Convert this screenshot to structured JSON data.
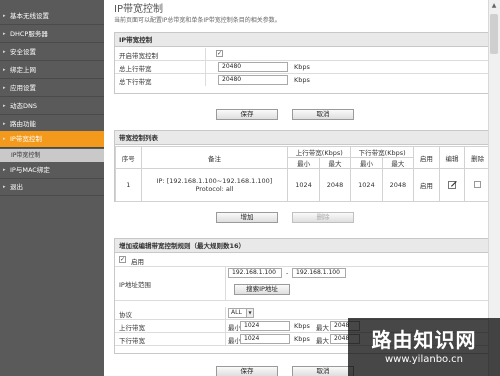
{
  "sidebar": {
    "items": [
      {
        "label": "基本无线设置"
      },
      {
        "label": "DHCP服务器"
      },
      {
        "label": "安全设置"
      },
      {
        "label": "绑定上网"
      },
      {
        "label": "应用设置"
      },
      {
        "label": "动态DNS"
      },
      {
        "label": "路由功能"
      },
      {
        "label": "IP带宽控制"
      }
    ],
    "subitems": [
      {
        "label": "IP带宽控制"
      },
      {
        "label": "IP与MAC绑定"
      }
    ],
    "last_item": {
      "label": "退出"
    }
  },
  "page": {
    "title": "IP带宽控制",
    "description": "当前页面可以配置IP总带宽和单条IP带宽控制条目的相关参数。"
  },
  "bandwidth_panel": {
    "header": "IP带宽控制",
    "enable_label": "开启带宽控制",
    "enable_checked": true,
    "up_label": "总上行带宽",
    "up_value": "20480",
    "down_label": "总下行带宽",
    "down_value": "20480",
    "unit": "Kbps"
  },
  "buttons": {
    "save": "保存",
    "cancel": "取消",
    "add": "增加",
    "delete": "删除",
    "search_ip": "搜索IP地址"
  },
  "rule_list": {
    "header": "带宽控制列表",
    "columns": {
      "seq": "序号",
      "note": "备注",
      "up": "上行带宽(Kbps)",
      "down": "下行带宽(Kbps)",
      "min": "最小",
      "max": "最大",
      "enable": "启用",
      "edit": "编辑",
      "delete": "删除"
    },
    "rows": [
      {
        "seq": "1",
        "ip": "IP: [192.168.1.100~192.168.1.100]",
        "protocol": "Protocol: all",
        "up_min": "1024",
        "up_max": "2048",
        "down_min": "1024",
        "down_max": "2048",
        "status": "启用"
      }
    ]
  },
  "edit_panel": {
    "header": "增加或编辑带宽控制规则（最大规则数16）",
    "enable_label": "启用",
    "enable_checked": true,
    "ip_range_label": "IP地址范围",
    "ip_start": "192.168.1.100",
    "ip_sep": "-",
    "ip_end": "192.168.1.100",
    "protocol_label": "协议",
    "protocol_value": "ALL",
    "up_label": "上行带宽",
    "down_label": "下行带宽",
    "min_label": "最小:",
    "max_label": "最大",
    "up_min": "1024",
    "up_max": "2048",
    "down_min": "1024",
    "down_max": "2048",
    "unit": "Kbps"
  },
  "watermark": {
    "title": "路由知识网",
    "url": "www.yilanbo.cn"
  }
}
